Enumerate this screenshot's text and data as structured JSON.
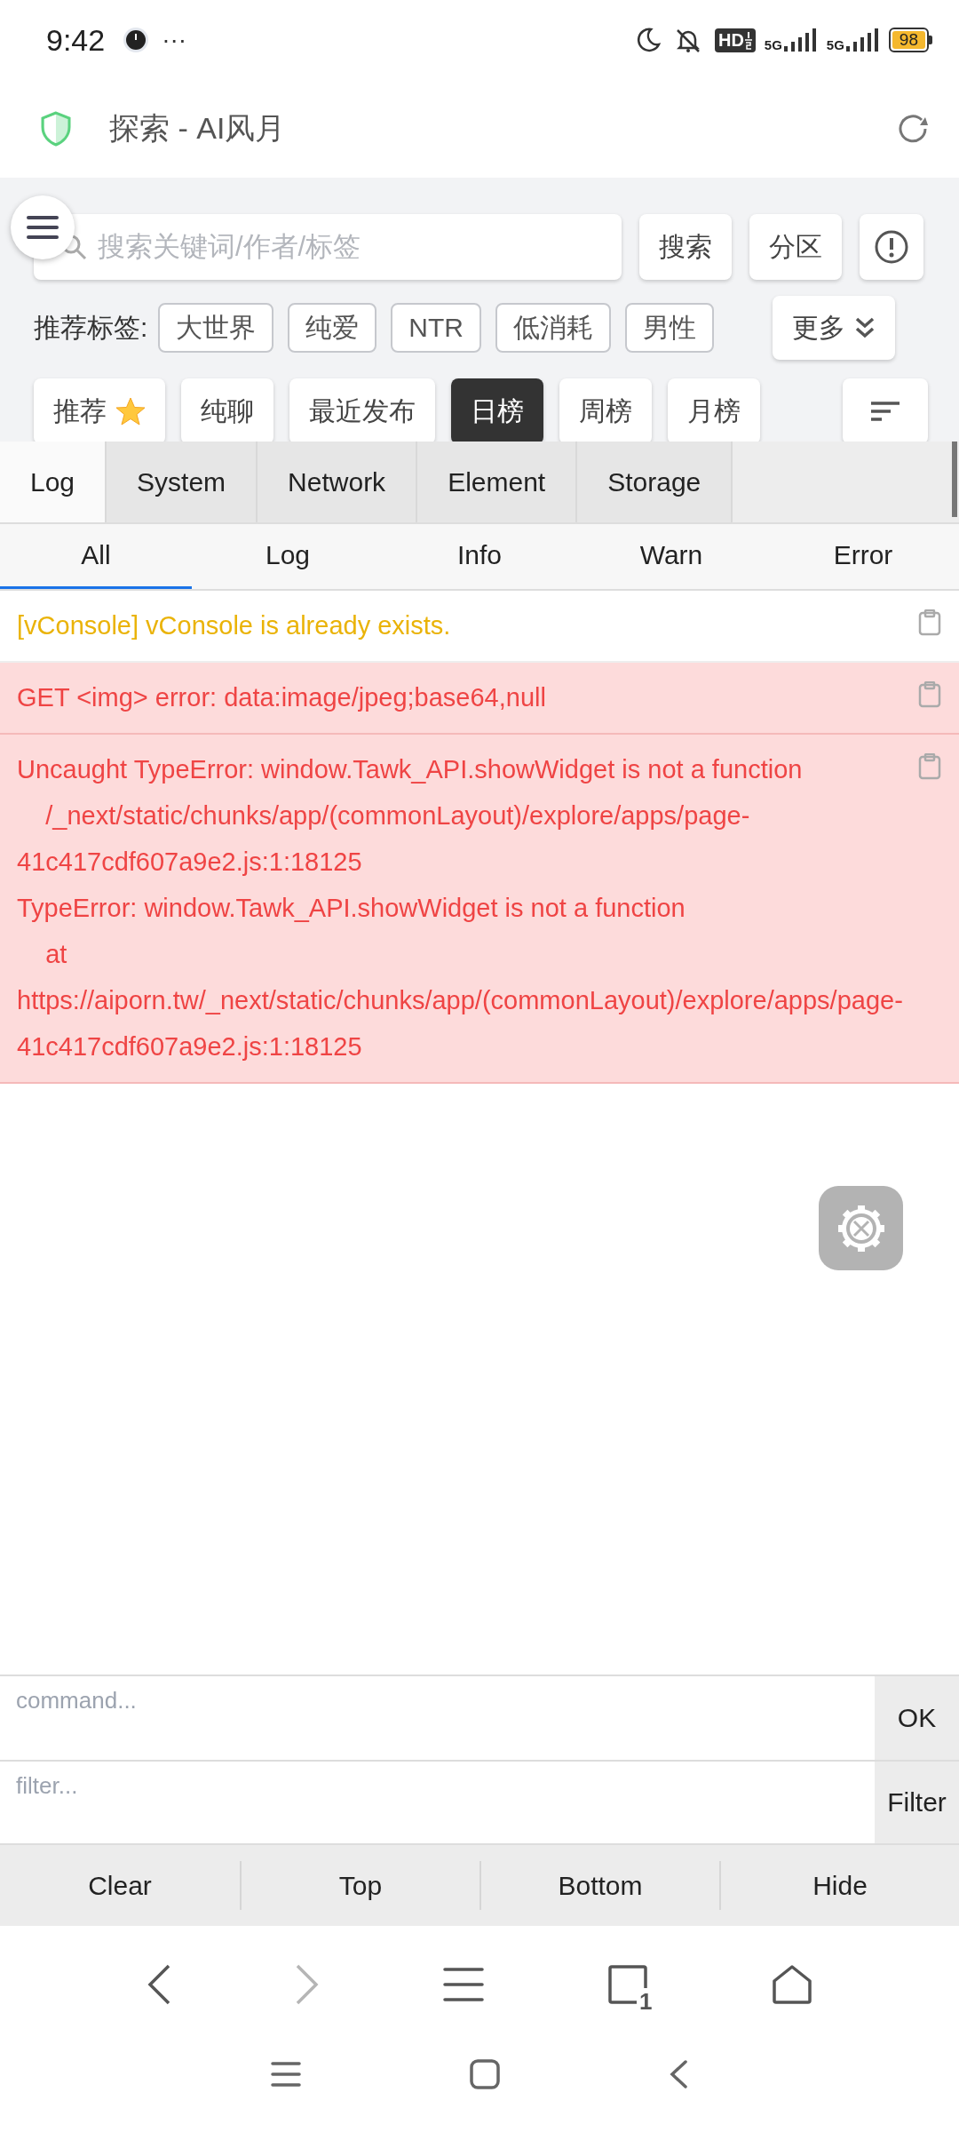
{
  "status_bar": {
    "time": "9:42",
    "more": "···",
    "hd_label": "HD",
    "sim1": "5G",
    "sim2": "5G",
    "battery": "98"
  },
  "title_bar": {
    "title": "探索 - AI风月"
  },
  "search": {
    "placeholder": "搜索关键词/作者/标签",
    "buttons": [
      "搜索",
      "分区"
    ]
  },
  "tags": {
    "label": "推荐标签:",
    "items": [
      "大世界",
      "纯爱",
      "NTR",
      "低消耗",
      "男性"
    ],
    "more": "更多"
  },
  "sort_tabs": [
    {
      "label": "推荐",
      "kind": "starred",
      "selected": false
    },
    {
      "label": "纯聊",
      "kind": "plain",
      "selected": false
    },
    {
      "label": "最近发布",
      "kind": "plain",
      "selected": false
    },
    {
      "label": "日榜",
      "kind": "plain",
      "selected": true
    },
    {
      "label": "周榜",
      "kind": "plain",
      "selected": false
    },
    {
      "label": "月榜",
      "kind": "plain",
      "selected": false
    }
  ],
  "vconsole": {
    "tabs": [
      {
        "label": "Log",
        "selected": true
      },
      {
        "label": "System",
        "selected": false
      },
      {
        "label": "Network",
        "selected": false
      },
      {
        "label": "Element",
        "selected": false
      },
      {
        "label": "Storage",
        "selected": false
      }
    ],
    "log_filters": [
      {
        "label": "All",
        "selected": true
      },
      {
        "label": "Log",
        "selected": false
      },
      {
        "label": "Info",
        "selected": false
      },
      {
        "label": "Warn",
        "selected": false
      },
      {
        "label": "Error",
        "selected": false
      }
    ],
    "logs": [
      {
        "kind": "warn",
        "text": "[vConsole] vConsole is already exists."
      },
      {
        "kind": "error",
        "text": "GET <img> error: data:image/jpeg;base64,null"
      },
      {
        "kind": "error",
        "text": "Uncaught TypeError: window.Tawk_API.showWidget is not a function\n    /_next/static/chunks/app/(commonLayout)/explore/apps/page-41c417cdf607a9e2.js:1:18125\nTypeError: window.Tawk_API.showWidget is not a function\n    at https://aiporn.tw/_next/static/chunks/app/(commonLayout)/explore/apps/page-41c417cdf607a9e2.js:1:18125"
      }
    ],
    "command_placeholder": "command...",
    "ok_button": "OK",
    "filter_placeholder": "filter...",
    "filter_button": "Filter",
    "actions": [
      "Clear",
      "Top",
      "Bottom",
      "Hide"
    ]
  },
  "browser_nav": {
    "forward_enabled": false,
    "tab_count": "1"
  }
}
